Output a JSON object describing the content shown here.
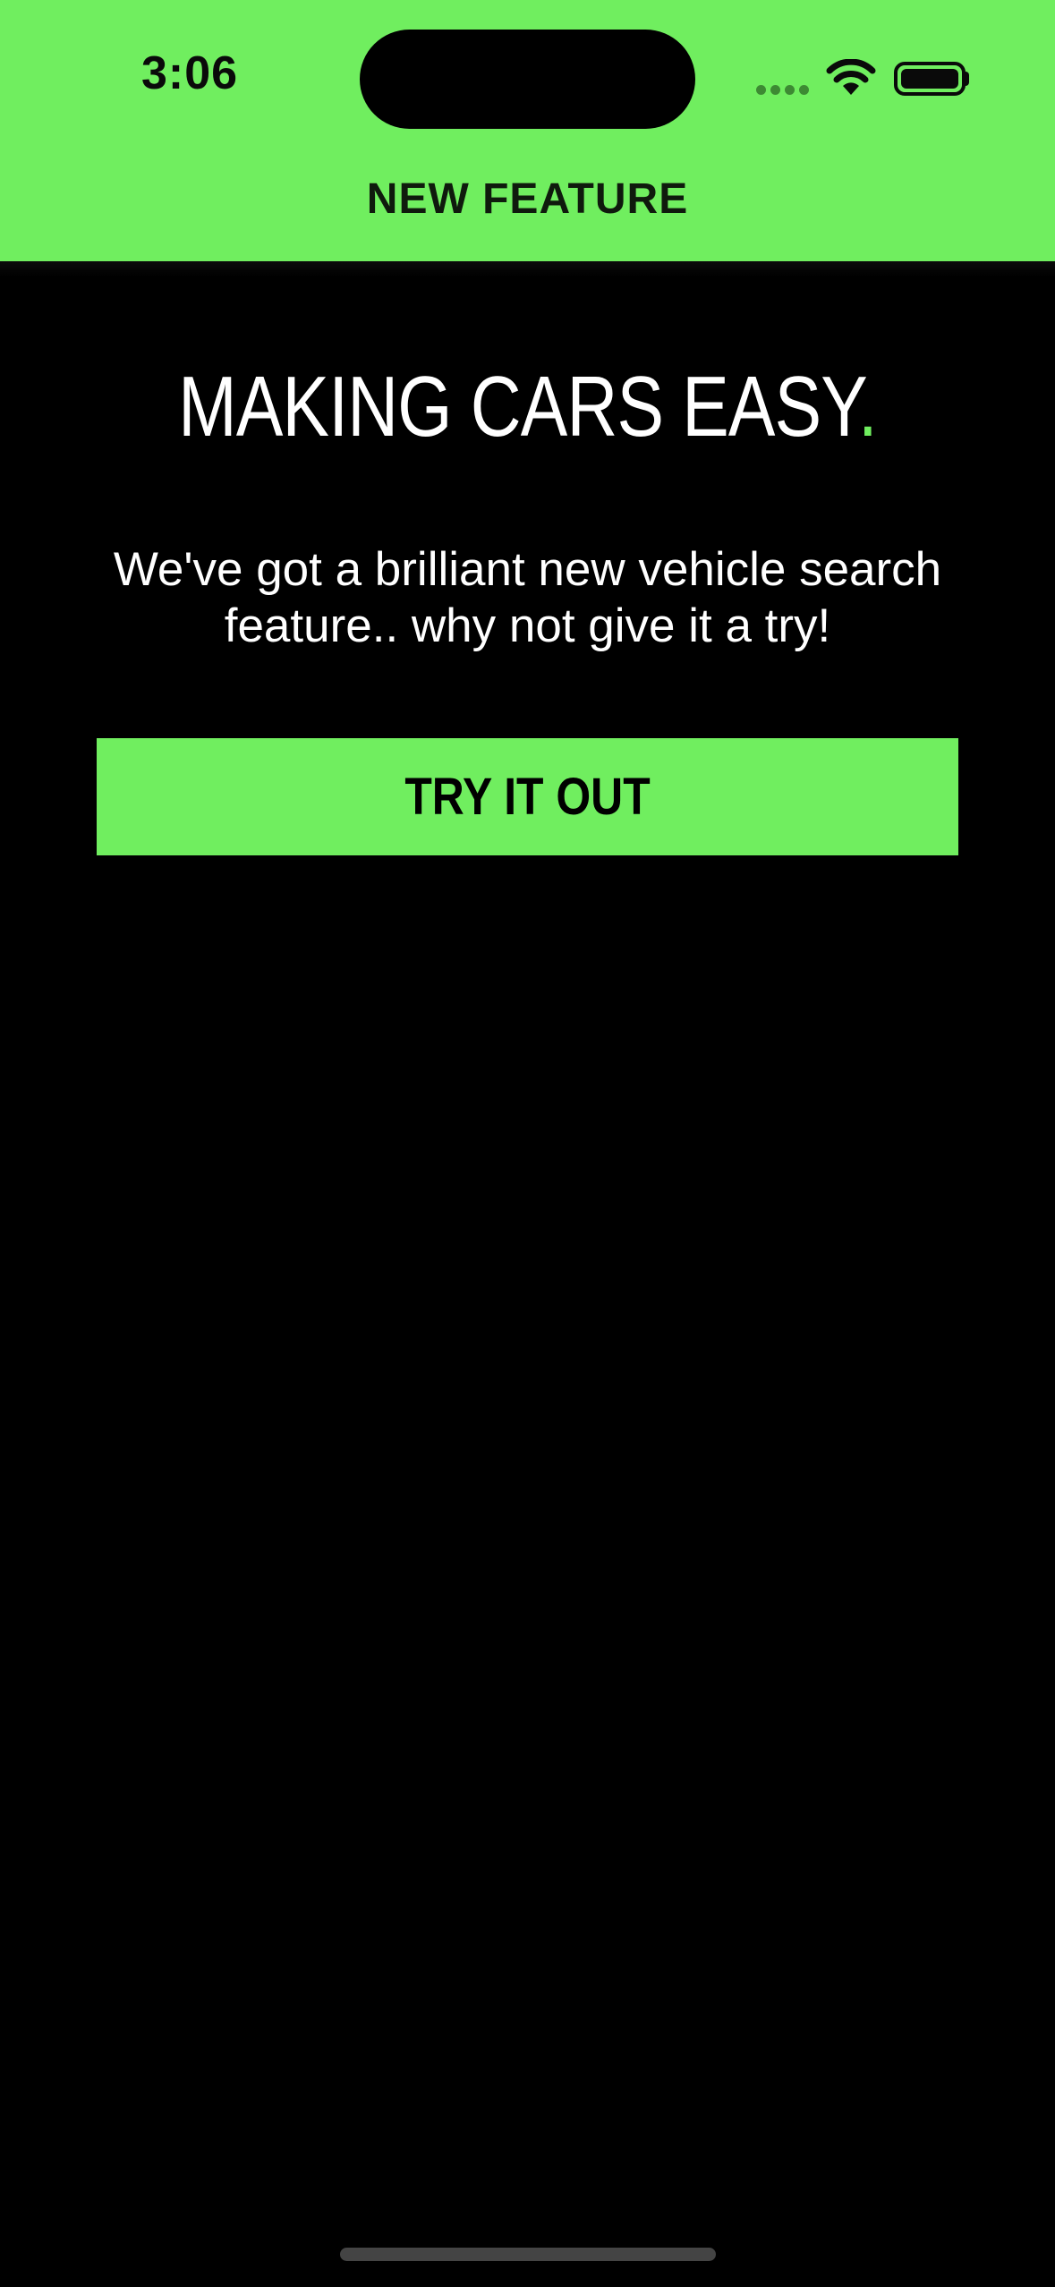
{
  "status_bar": {
    "time": "3:06",
    "icons": [
      "cellular-signal-icon",
      "wifi-icon",
      "battery-icon"
    ]
  },
  "nav": {
    "title": "NEW FEATURE"
  },
  "main": {
    "headline": "MAKING CARS EASY",
    "headline_dot": ".",
    "subtitle": "We've got a brilliant new vehicle search feature.. why not give it a try!",
    "cta_label": "TRY IT OUT"
  },
  "colors": {
    "accent": "#70ee5f",
    "background": "#000000",
    "text_primary": "#ffffff"
  }
}
